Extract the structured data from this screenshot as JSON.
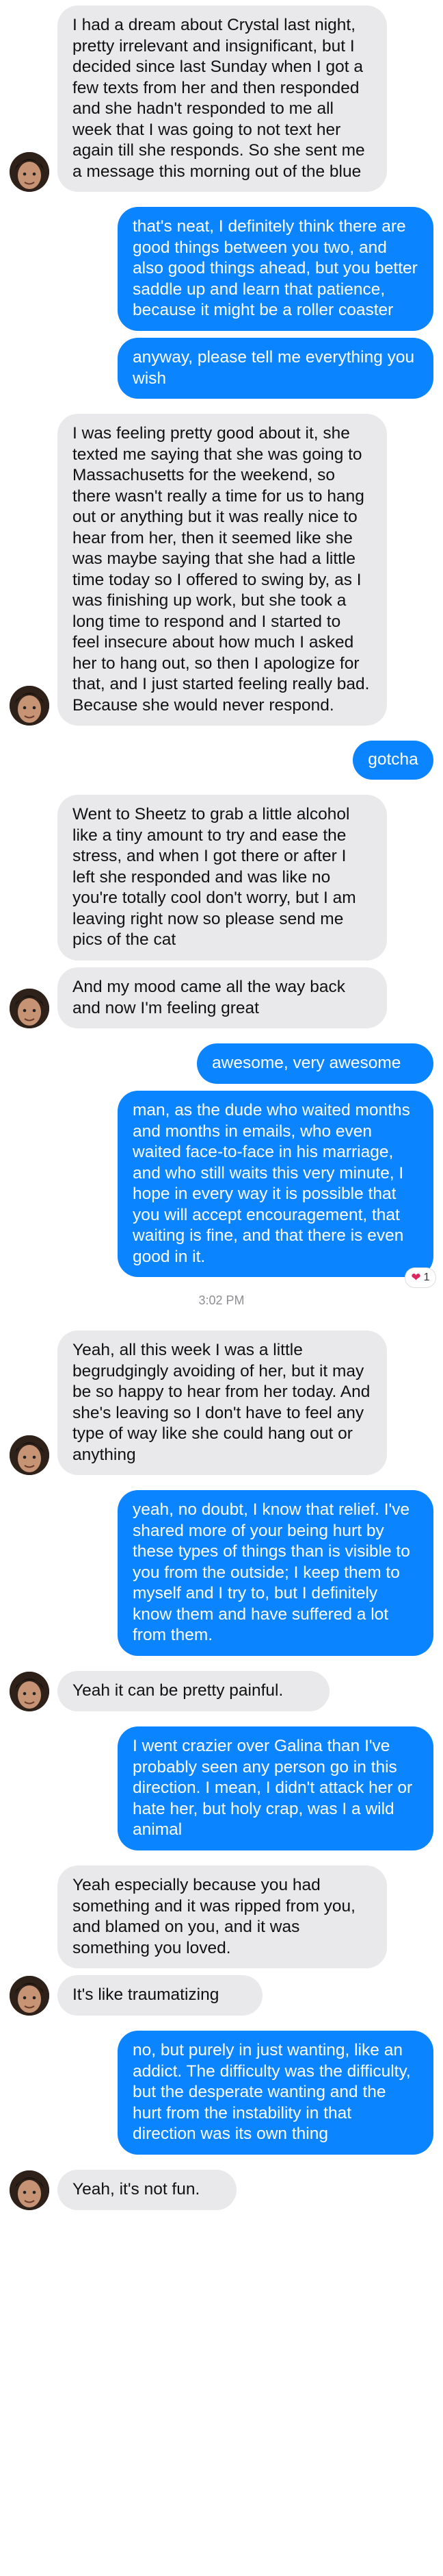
{
  "colors": {
    "outgoing_bubble": "#0a84ff",
    "incoming_bubble": "#e9e9eb",
    "reaction_heart": "#e0245e"
  },
  "messages": [
    {
      "text": "I had a dream about Crystal last night, pretty irrelevant and insignificant, but I decided since last Sunday when I got a few texts from her and then responded and she hadn't responded to me all week that I was going to not text her again till she responds. So she sent me a message this morning out of the blue"
    },
    {
      "text": "that's neat, I definitely think there are good things between you two, and also good things ahead, but you better saddle up and learn that patience, because it might be a roller coaster"
    },
    {
      "text": "anyway, please tell me everything you wish"
    },
    {
      "text": "I was feeling pretty good about it, she texted me saying that she was going to Massachusetts for the weekend, so there wasn't really a time for us to hang out or anything but it was really nice to hear from her, then it seemed like she was maybe saying that she had a little time today so I offered to swing by, as I was finishing up work, but she took a long time to respond and I started to feel insecure about how much I asked her to hang out, so then I apologize for that, and I just started feeling really bad. Because she would never respond."
    },
    {
      "text": "gotcha"
    },
    {
      "text": "Went to Sheetz to grab a little alcohol like a tiny amount to try and ease the stress, and when I got there or after I left she responded and was like no you're totally cool don't worry, but I am leaving right now so please send me pics of the cat"
    },
    {
      "text": "And my mood came all the way back and now I'm feeling great"
    },
    {
      "text": "awesome, very awesome"
    },
    {
      "text": "man, as the dude who waited months and months in emails, who even waited face-to-face in his marriage, and who still waits this very minute, I hope in every way it is possible that you will accept encouragement, that waiting is fine, and that there is even good in it.",
      "reaction": {
        "icon": "heart-icon",
        "count": "1"
      }
    },
    {
      "timestamp": "3:02 PM"
    },
    {
      "text": "Yeah, all this week I was a little begrudgingly avoiding of her, but it may be so happy to hear from her today. And she's leaving so I don't have to feel any type of way like she could hang out or anything"
    },
    {
      "text": "yeah, no doubt, I know that relief. I've shared more of your being hurt by these types of things than is visible to you from the outside; I keep them to myself and I try to, but I definitely know them and have suffered a lot from them."
    },
    {
      "text": "Yeah it can be pretty painful."
    },
    {
      "text": "I went crazier over Galina than I've probably seen any person go in this direction. I mean, I didn't attack her or hate her, but holy crap, was I a wild animal"
    },
    {
      "text": "Yeah especially because you had something and it was ripped from you, and blamed on you, and it was something you loved."
    },
    {
      "text": "It's like traumatizing"
    },
    {
      "text": "no, but purely in just wanting, like an addict. The difficulty was the difficulty, but the desperate wanting and the hurt from the instability in that direction was its own thing"
    },
    {
      "text": "Yeah, it's not fun."
    }
  ]
}
